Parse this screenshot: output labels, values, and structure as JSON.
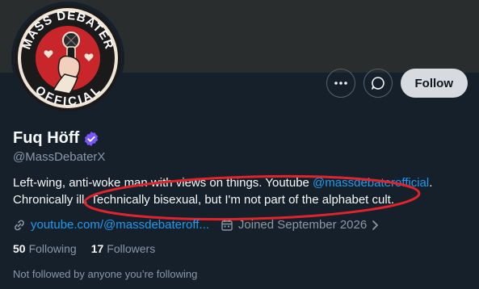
{
  "avatar": {
    "logo_text_top": "MASS DEBATER",
    "logo_text_bottom": "OFFICIAL",
    "colors": {
      "ring": "#1a1a1a",
      "fill": "#c9262c",
      "text": "#ffffff"
    }
  },
  "actions": {
    "more_icon": "ellipsis-icon",
    "message_icon": "message-bubble-icon",
    "follow_label": "Follow"
  },
  "profile": {
    "display_name": "Fuq Höff",
    "verified_icon": "verified-badge-icon",
    "handle": "@MassDebaterX"
  },
  "bio": {
    "line1_prefix": "Left-wing, anti-woke man with views on things. Youtube ",
    "mention": "@massdebaterofficial",
    "line1_suffix": ".",
    "line2": "Chronically ill. Technically bisexual, but I'm not part of the alphabet cult."
  },
  "meta": {
    "link_icon": "link-icon",
    "link_text": "youtube.com/@massdebateroff...",
    "joined_icon": "calendar-icon",
    "joined_text": "Joined September 2026",
    "chevron_icon": "chevron-right-icon"
  },
  "stats": {
    "following_count": "50",
    "following_label": "Following",
    "followers_count": "17",
    "followers_label": "Followers"
  },
  "not_followed_text": "Not followed by anyone you’re following",
  "colors": {
    "background": "#15202b",
    "link": "#1d9bf0",
    "secondary_text": "#8b98a5",
    "verified": "#7856ff",
    "annotation": "#e0242b"
  }
}
